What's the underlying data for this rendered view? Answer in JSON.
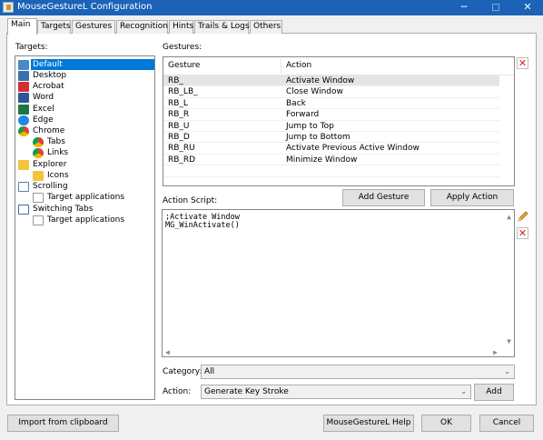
{
  "window": {
    "title": "MouseGestureL Configuration",
    "minimize_glyph": "─",
    "close_glyph": "✕"
  },
  "tabs": [
    "Main",
    "Targets",
    "Gestures",
    "Recognition",
    "Hints",
    "Trails & Logs",
    "Others"
  ],
  "targets_panel": {
    "label": "Targets:",
    "items": [
      "Default",
      "Desktop",
      "Acrobat",
      "Word",
      "Excel",
      "Edge",
      "Chrome",
      "Tabs",
      "Links",
      "Explorer",
      "Icons",
      "Scrolling",
      "Target applications",
      "Switching Tabs",
      "Target applications"
    ]
  },
  "gestures_panel": {
    "label": "Gestures:",
    "columns": [
      "Gesture",
      "Action"
    ],
    "rows": [
      [
        "RB_",
        "Activate Window"
      ],
      [
        "RB_LB_",
        "Close Window"
      ],
      [
        "RB_L",
        "Back"
      ],
      [
        "RB_R",
        "Forward"
      ],
      [
        "RB_U",
        "Jump to Top"
      ],
      [
        "RB_D",
        "Jump to Bottom"
      ],
      [
        "RB_RU",
        "Activate Previous Active Window"
      ],
      [
        "RB_RD",
        "Minimize Window"
      ]
    ],
    "delete_glyph": "✕"
  },
  "action_script": {
    "label": "Action Script:",
    "add_gesture": "Add Gesture",
    "apply_action": "Apply Action",
    "lines": [
      ";Activate Window",
      "MG_WinActivate()"
    ],
    "delete_glyph": "✕"
  },
  "category": {
    "label": "Category:",
    "value": "All"
  },
  "action": {
    "label": "Action:",
    "value": "Generate Key Stroke",
    "add_label": "Add"
  },
  "footer": {
    "import": "Import from clipboard",
    "help": "MouseGestureL Help",
    "ok": "OK",
    "cancel": "Cancel"
  },
  "colors": {
    "titlebar": "#1c63b7",
    "selection": "#0078d7",
    "delete": "#d71f1f"
  }
}
